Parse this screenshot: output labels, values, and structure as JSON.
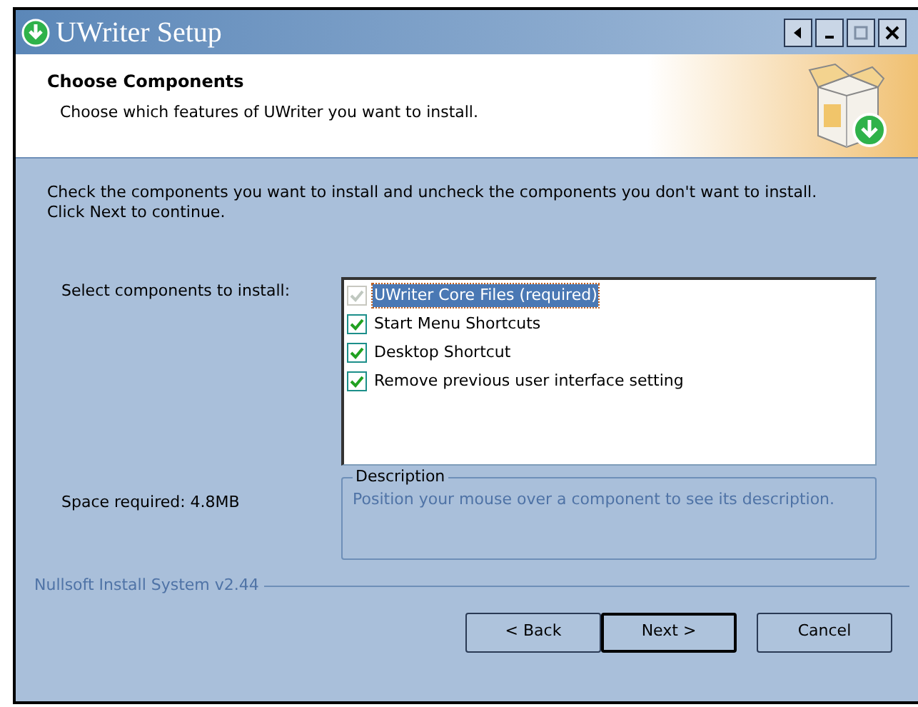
{
  "window": {
    "title": "UWriter Setup"
  },
  "header": {
    "title": "Choose Components",
    "subtitle": "Choose which features of UWriter you want to install."
  },
  "instructions": "Check the components you want to install and uncheck the components you don't want to install. Click Next to continue.",
  "select_label": "Select components to install:",
  "components": [
    {
      "label": "UWriter Core Files (required)",
      "checked": true,
      "disabled": true,
      "selected": true
    },
    {
      "label": "Start Menu Shortcuts",
      "checked": true,
      "disabled": false,
      "selected": false
    },
    {
      "label": "Desktop Shortcut",
      "checked": true,
      "disabled": false,
      "selected": false
    },
    {
      "label": "Remove previous user interface setting",
      "checked": true,
      "disabled": false,
      "selected": false
    }
  ],
  "space_required": "Space required: 4.8MB",
  "description": {
    "title": "Description",
    "text": "Position your mouse over a component to see its description."
  },
  "branding": "Nullsoft Install System v2.44",
  "buttons": [
    {
      "label": "< Back",
      "default": false
    },
    {
      "label": "Next >",
      "default": true
    },
    {
      "label": "Cancel",
      "default": false
    }
  ]
}
